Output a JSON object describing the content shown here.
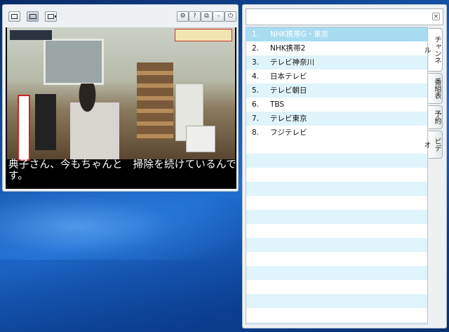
{
  "player": {
    "toolbar": {
      "left_buttons": [
        "mode-small",
        "mode-wide",
        "mode-side"
      ],
      "right_buttons": [
        {
          "name": "settings",
          "glyph": "⚙"
        },
        {
          "name": "help",
          "glyph": "?"
        },
        {
          "name": "popout",
          "glyph": "⧉"
        },
        {
          "name": "minimize",
          "glyph": "–"
        },
        {
          "name": "power",
          "glyph": "⏻"
        }
      ]
    },
    "subtitle": "典子さん、今もちゃんと　掃除を続けているんです。"
  },
  "panel": {
    "search": {
      "value": "",
      "placeholder": ""
    },
    "clear_glyph": "×",
    "channels": [
      {
        "num": "1.",
        "name": "NHK携帯G・東京",
        "selected": true
      },
      {
        "num": "2.",
        "name": "NHK携帯2"
      },
      {
        "num": "3.",
        "name": "テレビ神奈川"
      },
      {
        "num": "4.",
        "name": "日本テレビ"
      },
      {
        "num": "5.",
        "name": "テレビ朝日"
      },
      {
        "num": "6.",
        "name": "TBS"
      },
      {
        "num": "7.",
        "name": "テレビ東京"
      },
      {
        "num": "8.",
        "name": "フジテレビ"
      }
    ],
    "tabs": [
      "チャンネル",
      "番組表",
      "予約",
      "ビデオ"
    ]
  }
}
